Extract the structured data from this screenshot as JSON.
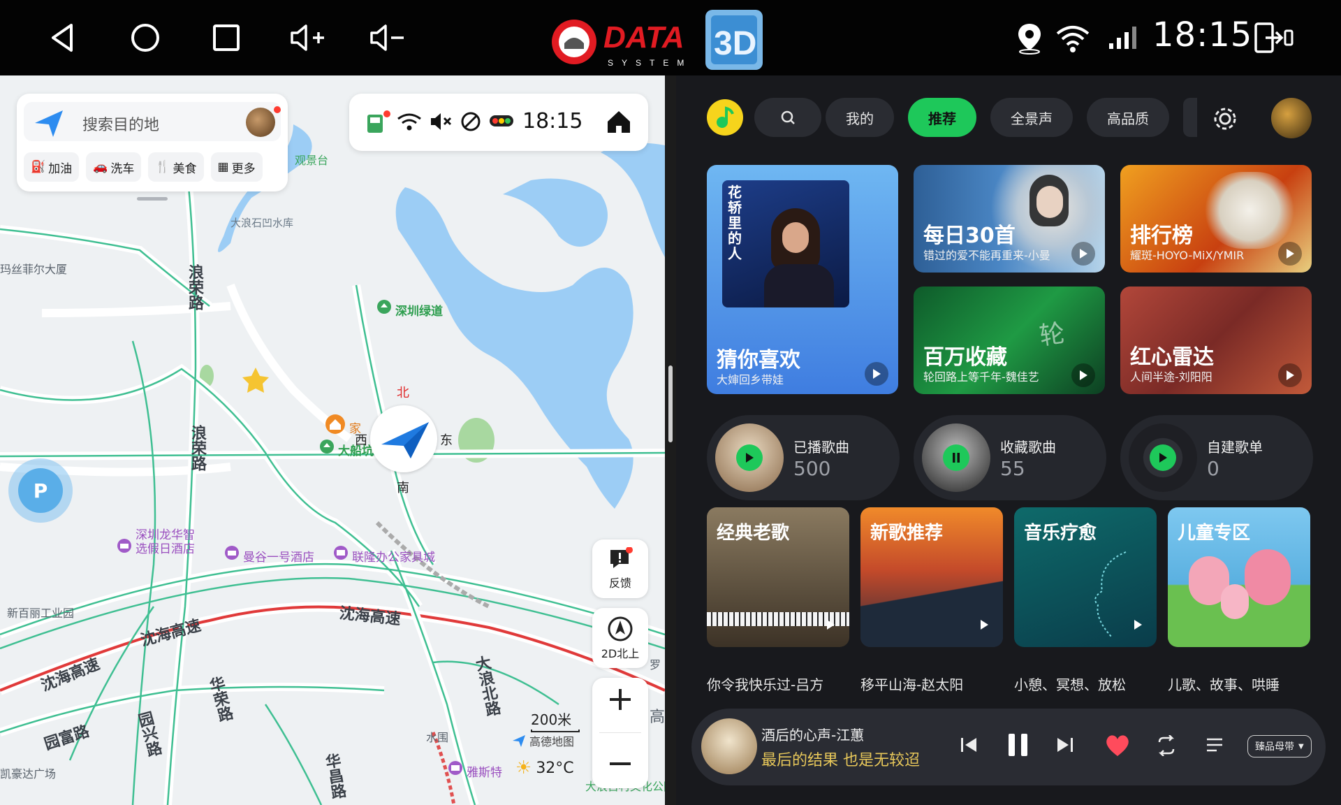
{
  "statusbar": {
    "nav_back": "back-icon",
    "nav_home": "home-icon",
    "nav_recents": "recents-icon",
    "vol_up": "volume-up-icon",
    "vol_down": "volume-down-icon",
    "logo_text": "DATA",
    "logo_sub": "SYSTEM",
    "logo_3d": "3D",
    "time": "18:15"
  },
  "map": {
    "search_placeholder": "搜索目的地",
    "quick_chips": [
      "加油",
      "洗车",
      "美食",
      "更多"
    ],
    "status_time": "18:15",
    "compass": {
      "n": "北",
      "s": "南",
      "e": "东",
      "w": "西"
    },
    "home_label": "家",
    "feedback_label": "反馈",
    "north_up_label": "2D北上",
    "scale": "200米",
    "brand": "高德地图",
    "weather_temp": "32°C",
    "places": {
      "guanjingtai": "观景台",
      "reservoir": "大浪石凹水库",
      "masi": "玛丝菲尔大厦",
      "greenway": "深圳绿道",
      "dachuankeng": "大船坑",
      "longhua_hotel_1": "深圳龙华智",
      "longhua_hotel_2": "选假日酒店",
      "mangu": "曼谷一号酒店",
      "lianlong": "联隆办公家具城",
      "xinbaili": "新百丽工业园",
      "kaihaoda": "凯豪达广场",
      "yasite": "雅斯特",
      "shuiwei": "水围",
      "park": "大浪古村文化公园",
      "luo": "罗",
      "gao": "高"
    },
    "roads": {
      "langrong_1": "浪荣路",
      "langrong_2": "浪荣路",
      "shenhai_1": "沈海高速",
      "shenhai_2": "沈海高速",
      "shenhai_3": "沈海高速",
      "huarong": "华荣路",
      "yuanfu": "园富路",
      "yuanxing": "园兴路",
      "huachang": "华昌路",
      "dalangbei": "大浪北路"
    }
  },
  "music": {
    "tabs": [
      "我的",
      "推荐",
      "全景声",
      "高品质"
    ],
    "active_tab": "推荐",
    "featured": {
      "title": "猜你喜欢",
      "sub": "大婶回乡带娃",
      "art_text": "花轿里的人"
    },
    "tiles": [
      {
        "title": "每日30首",
        "sub": "错过的爱不能再重来-小曼"
      },
      {
        "title": "排行榜",
        "sub": "耀斑-HOYO-MiX/YMIR"
      },
      {
        "title": "百万收藏",
        "sub": "轮回路上等千年-魏佳艺"
      },
      {
        "title": "红心雷达",
        "sub": "人间半途-刘阳阳"
      }
    ],
    "pills": [
      {
        "label": "已播歌曲",
        "count": "500"
      },
      {
        "label": "收藏歌曲",
        "count": "55"
      },
      {
        "label": "自建歌单",
        "count": "0"
      }
    ],
    "categories": [
      {
        "title": "经典老歌",
        "sub": "你令我快乐过-吕方"
      },
      {
        "title": "新歌推荐",
        "sub": "移平山海-赵太阳"
      },
      {
        "title": "音乐疗愈",
        "sub": "小憩、冥想、放松"
      },
      {
        "title": "儿童专区",
        "sub": "儿歌、故事、哄睡"
      }
    ],
    "player": {
      "song": "酒后的心声-江蕙",
      "lyric": "最后的结果 也是无较迢",
      "quality": "臻品母带"
    },
    "colors": {
      "accent": "#1ec85a",
      "lyric": "#e8c85a",
      "heart": "#ff4b5c"
    }
  }
}
